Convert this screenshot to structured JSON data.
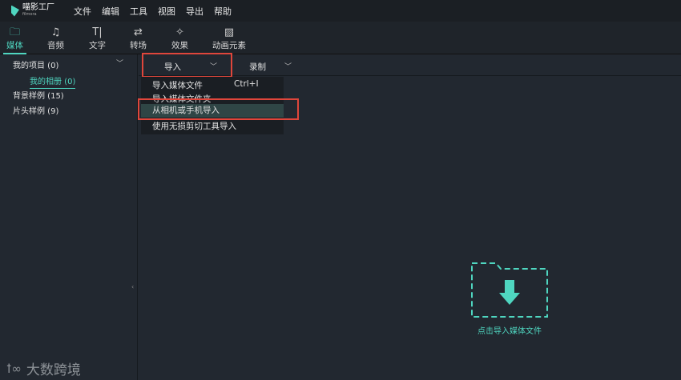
{
  "app": {
    "logo_text": "喵影工厂",
    "logo_sub": "filmora"
  },
  "menu": [
    "文件",
    "编辑",
    "工具",
    "视图",
    "导出",
    "帮助"
  ],
  "tabs": [
    {
      "label": "媒体",
      "icon": "folder-icon"
    },
    {
      "label": "音频",
      "icon": "music-note-icon"
    },
    {
      "label": "文字",
      "icon": "text-icon"
    },
    {
      "label": "转场",
      "icon": "transition-icon"
    },
    {
      "label": "效果",
      "icon": "effects-icon"
    },
    {
      "label": "动画元素",
      "icon": "image-icon"
    }
  ],
  "sidebar": {
    "items": [
      "我的项目 (0)",
      "我的相册 (0)",
      "背景样例 (15)",
      "片头样例 (9)"
    ]
  },
  "main": {
    "import_label": "导入",
    "record_label": "录制",
    "dropdown": [
      {
        "label": "导入媒体文件",
        "shortcut": "Ctrl+I"
      },
      {
        "label": "导入媒体文件夹"
      },
      {
        "label": "从相机或手机导入"
      },
      {
        "label": "使用无损剪切工具导入"
      }
    ],
    "empty_label": "点击导入媒体文件"
  },
  "watermark": "大数跨境",
  "colors": {
    "accent": "#4fd6c0",
    "highlight": "#e0463b"
  }
}
